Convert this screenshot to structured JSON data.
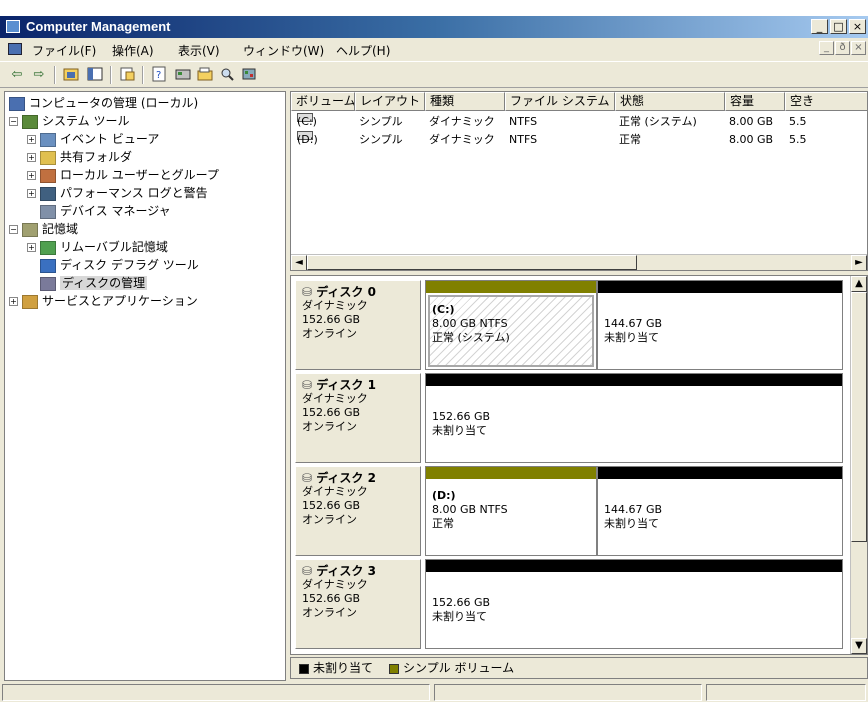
{
  "window": {
    "title": "Computer Management",
    "caption_buttons": [
      "_",
      "□",
      "×"
    ],
    "mdi_buttons": [
      "_",
      "ð",
      "×"
    ]
  },
  "menu": [
    "ファイル(F)",
    "操作(A)",
    "表示(V)",
    "ウィンドウ(W)",
    "ヘルプ(H)"
  ],
  "toolbar": {
    "icons": [
      "back-arrow-icon",
      "forward-arrow-icon",
      "up-folder-icon",
      "show-hide-tree-icon",
      "properties-icon",
      "help-icon",
      "disk-properties-icon",
      "open-icon",
      "find-icon",
      "settings-icon"
    ]
  },
  "tree": {
    "root": "コンピュータの管理 (ローカル)",
    "items": [
      {
        "label": "システム ツール",
        "expander": "−"
      },
      {
        "label": "イベント ビューア",
        "expander": "+"
      },
      {
        "label": "共有フォルダ",
        "expander": "+"
      },
      {
        "label": "ローカル ユーザーとグループ",
        "expander": "+"
      },
      {
        "label": "パフォーマンス ログと警告",
        "expander": "+"
      },
      {
        "label": "デバイス マネージャ",
        "expander": ""
      },
      {
        "label": "記憶域",
        "expander": "−"
      },
      {
        "label": "リムーバブル記憶域",
        "expander": "+"
      },
      {
        "label": "ディスク デフラグ ツール",
        "expander": ""
      },
      {
        "label": "ディスクの管理",
        "expander": ""
      },
      {
        "label": "サービスとアプリケーション",
        "expander": "+"
      }
    ]
  },
  "volumes": {
    "headers": [
      "ボリューム",
      "レイアウト",
      "種類",
      "ファイル システム",
      "状態",
      "容量",
      "空き"
    ],
    "rows": [
      [
        "(C:)",
        "シンプル",
        "ダイナミック",
        "NTFS",
        "正常 (システム)",
        "8.00 GB",
        "5.5"
      ],
      [
        "(D:)",
        "シンプル",
        "ダイナミック",
        "NTFS",
        "正常",
        "8.00 GB",
        "5.5"
      ]
    ],
    "scroll_left": "◄",
    "scroll_right": "►"
  },
  "disks": [
    {
      "name": "ディスク 0",
      "type": "ダイナミック",
      "size": "152.66 GB",
      "status": "オンライン",
      "partitions": [
        {
          "title": "(C:)",
          "size": "8.00 GB NTFS",
          "state": "正常 (システム)",
          "kind": "simple",
          "selected": true
        },
        {
          "title": "",
          "size": "144.67 GB",
          "state": "未割り当て",
          "kind": "unallocated"
        }
      ]
    },
    {
      "name": "ディスク 1",
      "type": "ダイナミック",
      "size": "152.66 GB",
      "status": "オンライン",
      "partitions": [
        {
          "title": "",
          "size": "152.66 GB",
          "state": "未割り当て",
          "kind": "unallocated"
        }
      ]
    },
    {
      "name": "ディスク 2",
      "type": "ダイナミック",
      "size": "152.66 GB",
      "status": "オンライン",
      "partitions": [
        {
          "title": "(D:)",
          "size": "8.00 GB NTFS",
          "state": "正常",
          "kind": "simple"
        },
        {
          "title": "",
          "size": "144.67 GB",
          "state": "未割り当て",
          "kind": "unallocated"
        }
      ]
    },
    {
      "name": "ディスク 3",
      "type": "ダイナミック",
      "size": "152.66 GB",
      "status": "オンライン",
      "partitions": [
        {
          "title": "",
          "size": "152.66 GB",
          "state": "未割り当て",
          "kind": "unallocated"
        }
      ]
    }
  ],
  "legend": [
    {
      "label": "未割り当て",
      "color": "#000000"
    },
    {
      "label": "シンプル ボリューム",
      "color": "#808000"
    }
  ],
  "colors": {
    "simple": "#808000",
    "unallocated": "#000000",
    "title_start": "#0a246a",
    "title_end": "#a6caf0"
  },
  "scroll": {
    "up": "▲",
    "down": "▼"
  }
}
